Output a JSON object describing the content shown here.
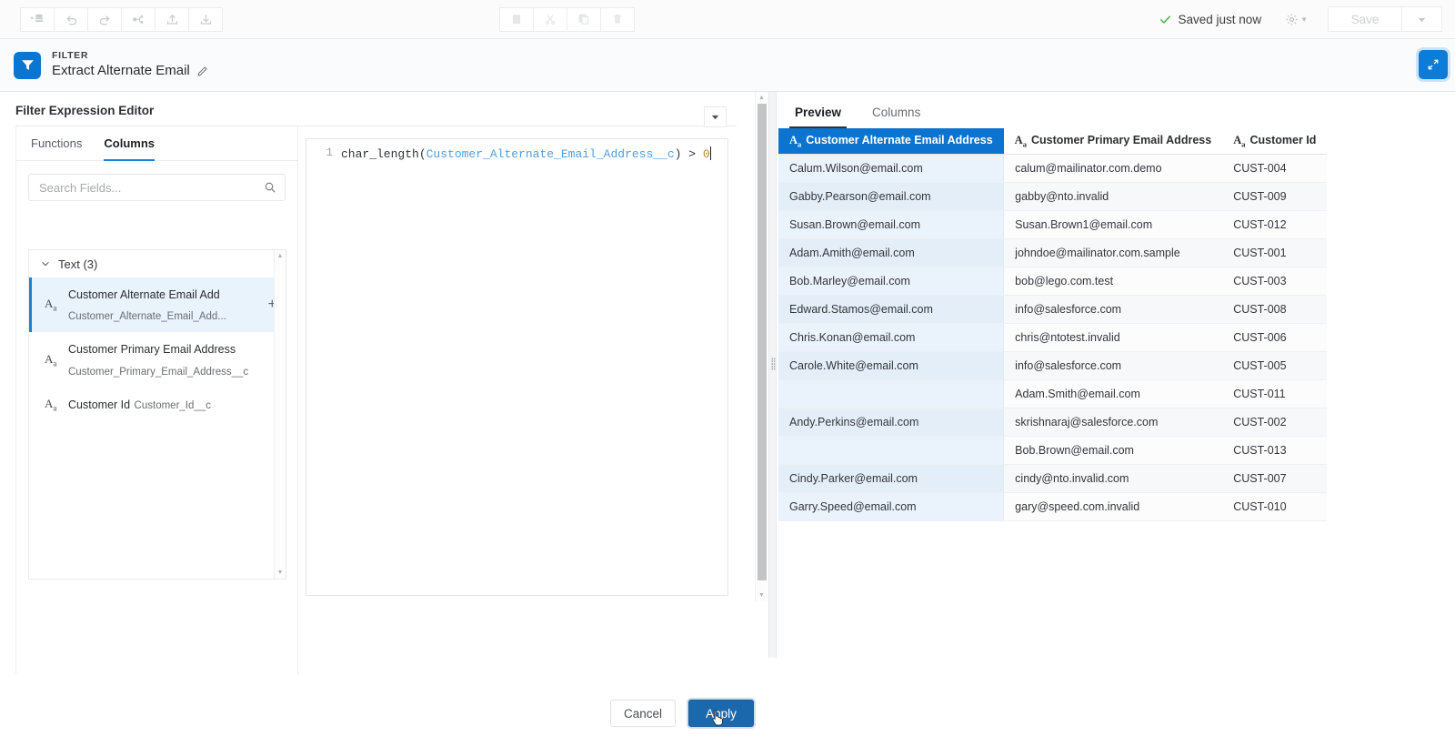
{
  "toolbar": {
    "left_icons": [
      {
        "name": "add-data-icon",
        "title": "Add Data"
      },
      {
        "name": "undo-icon",
        "title": "Undo"
      },
      {
        "name": "redo-icon",
        "title": "Redo"
      },
      {
        "name": "transform-icon",
        "title": "Transform"
      },
      {
        "name": "upload-icon",
        "title": "Upload"
      },
      {
        "name": "download-icon",
        "title": "Download"
      }
    ],
    "center_icons": [
      {
        "name": "paste-icon",
        "title": "Paste"
      },
      {
        "name": "cut-icon",
        "title": "Cut"
      },
      {
        "name": "copy-icon",
        "title": "Copy"
      },
      {
        "name": "delete-icon",
        "title": "Delete"
      }
    ],
    "saved_status": "Saved just now",
    "save_label": "Save"
  },
  "node": {
    "kind": "FILTER",
    "title": "Extract Alternate Email"
  },
  "editor": {
    "title": "Filter Expression Editor",
    "tabs": [
      {
        "label": "Functions",
        "active": false
      },
      {
        "label": "Columns",
        "active": true
      }
    ],
    "search": {
      "value": "",
      "placeholder": "Search Fields..."
    },
    "group": {
      "label": "Text (3)"
    },
    "fields": [
      {
        "label": "Customer Alternate Email Add",
        "api": "Customer_Alternate_Email_Add...",
        "type": "Aa",
        "selected": true
      },
      {
        "label": "Customer Primary Email Address",
        "api": "Customer_Primary_Email_Address__c",
        "type": "Aa",
        "selected": false
      },
      {
        "label": "Customer Id",
        "api": "Customer_Id__c",
        "type": "Aa",
        "selected": false
      }
    ],
    "code": {
      "line_number": "1",
      "function_part": "char_length(",
      "column_part": "Customer_Alternate_Email_Address__c",
      "operator_part": ") > ",
      "number_part": "0"
    }
  },
  "footer": {
    "cancel_label": "Cancel",
    "apply_label": "Apply"
  },
  "preview": {
    "tabs": [
      {
        "label": "Preview",
        "active": true
      },
      {
        "label": "Columns",
        "active": false
      }
    ],
    "columns": [
      {
        "label": "Customer Alternate Email Address",
        "type": "Aa",
        "primary": true
      },
      {
        "label": "Customer Primary Email Address",
        "type": "Aa",
        "primary": false
      },
      {
        "label": "Customer Id",
        "type": "Aa",
        "primary": false
      }
    ],
    "rows": [
      [
        "Calum.Wilson@email.com",
        "calum@mailinator.com.demo",
        "CUST-004"
      ],
      [
        "Gabby.Pearson@email.com",
        "gabby@nto.invalid",
        "CUST-009"
      ],
      [
        "Susan.Brown@email.com",
        "Susan.Brown1@email.com",
        "CUST-012"
      ],
      [
        "Adam.Amith@email.com",
        "johndoe@mailinator.com.sample",
        "CUST-001"
      ],
      [
        "Bob.Marley@email.com",
        "bob@lego.com.test",
        "CUST-003"
      ],
      [
        "Edward.Stamos@email.com",
        "info@salesforce.com",
        "CUST-008"
      ],
      [
        "Chris.Konan@email.com",
        "chris@ntotest.invalid",
        "CUST-006"
      ],
      [
        "Carole.White@email.com",
        "info@salesforce.com",
        "CUST-005"
      ],
      [
        "",
        "Adam.Smith@email.com",
        "CUST-011"
      ],
      [
        "Andy.Perkins@email.com",
        "skrishnaraj@salesforce.com",
        "CUST-002"
      ],
      [
        "",
        "Bob.Brown@email.com",
        "CUST-013"
      ],
      [
        "Cindy.Parker@email.com",
        "cindy@nto.invalid.com",
        "CUST-007"
      ],
      [
        "Garry.Speed@email.com",
        "gary@speed.com.invalid",
        "CUST-010"
      ]
    ]
  },
  "colors": {
    "accent_blue": "#0d7bd8",
    "primary_header_blue": "#0c74cf",
    "apply_button_blue": "#1b68ad",
    "saved_green": "#4caf50",
    "selected_row_blue": "#e9f3fc"
  }
}
